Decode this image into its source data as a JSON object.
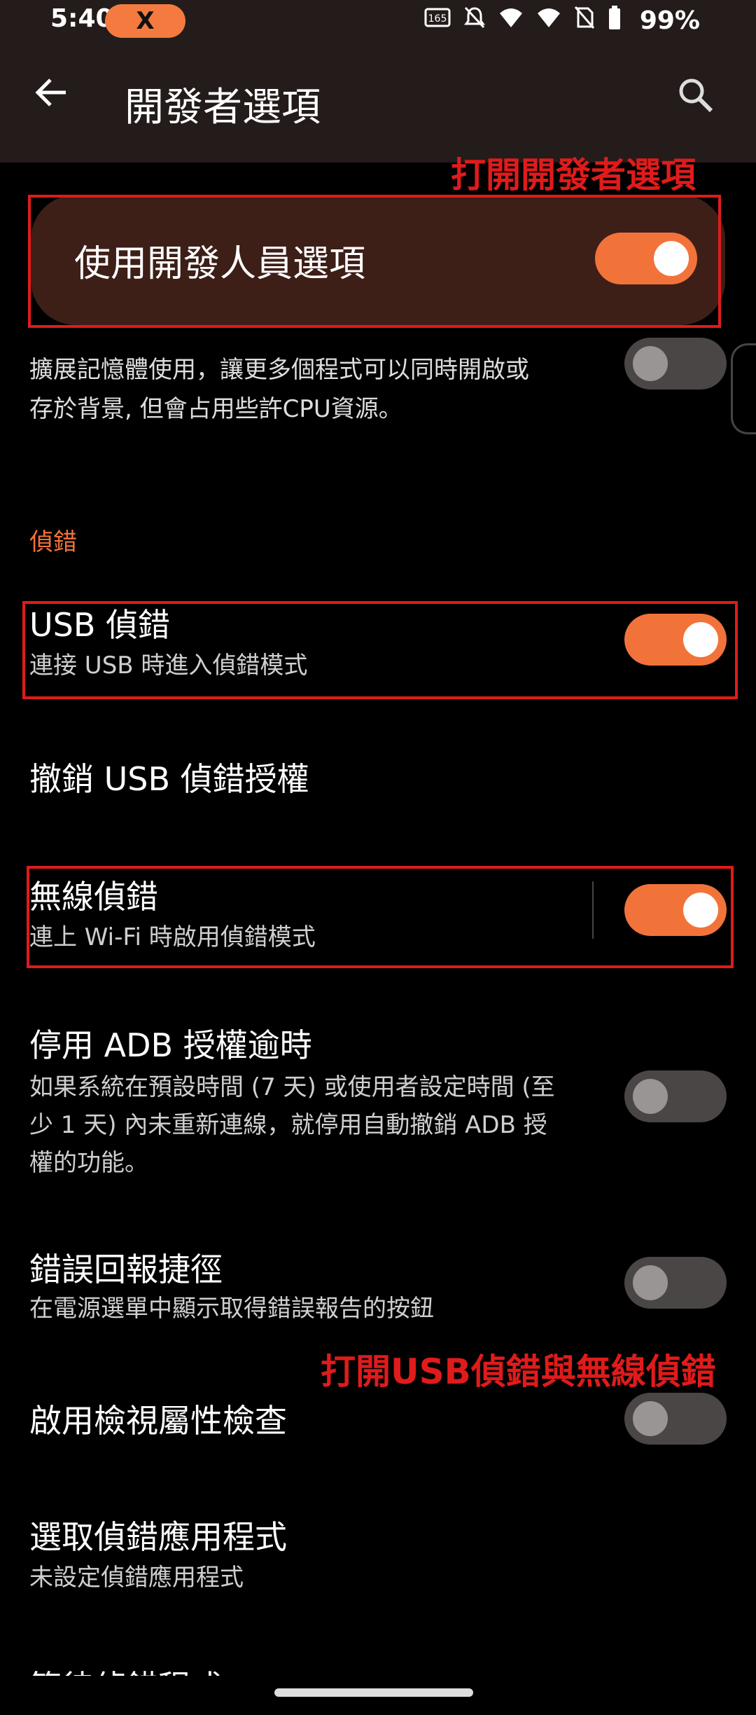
{
  "status_bar": {
    "time": "5:40",
    "notification_badge": "X",
    "battery": "99%",
    "icons": [
      "165hz-icon",
      "bell-off-icon",
      "wifi-6-icon",
      "wifi-6-icon",
      "no-sim-icon",
      "battery-icon"
    ]
  },
  "app_bar": {
    "title": "開發者選項",
    "back_icon": "arrow-left-icon",
    "search_icon": "search-icon"
  },
  "annotations": {
    "top_note": "打開開發者選項",
    "middle_note": "打開USB偵錯與無線偵錯",
    "color": "#e01b1b"
  },
  "master_switch": {
    "label": "使用開發人員選項",
    "checked": true
  },
  "memory_item": {
    "line1": "擴展記憶體使用，讓更多個程式可以同時開啟或",
    "line2": "存於背景, 但會占用些許CPU資源。",
    "checked": false
  },
  "section": {
    "title": "偵錯"
  },
  "items": {
    "usb_debugging": {
      "title": "USB 偵錯",
      "subtitle": "連接 USB 時進入偵錯模式",
      "checked": true
    },
    "revoke_usb": {
      "title": "撤銷 USB 偵錯授權"
    },
    "wireless_debugging": {
      "title": "無線偵錯",
      "subtitle": "連上 Wi-Fi 時啟用偵錯模式",
      "checked": true
    },
    "adb_timeout": {
      "title": "停用 ADB 授權逾時",
      "sub1": "如果系統在預設時間 (7 天) 或使用者設定時間 (至",
      "sub2": "少 1 天) 內未重新連線，就停用自動撤銷 ADB 授",
      "sub3": "權的功能。",
      "checked": false
    },
    "bug_report": {
      "title": "錯誤回報捷徑",
      "subtitle": "在電源選單中顯示取得錯誤報告的按鈕",
      "checked": false
    },
    "view_attr": {
      "title": "啟用檢視屬性檢查",
      "checked": false
    },
    "debug_app": {
      "title": "選取偵錯應用程式",
      "subtitle": "未設定偵錯應用程式"
    },
    "wait_debugger": {
      "title": "等待偵錯程式"
    }
  },
  "colors": {
    "accent": "#f2733a",
    "toggle_off": "#4b4646",
    "card": "#3d1f18",
    "appbar": "#231c1a"
  }
}
